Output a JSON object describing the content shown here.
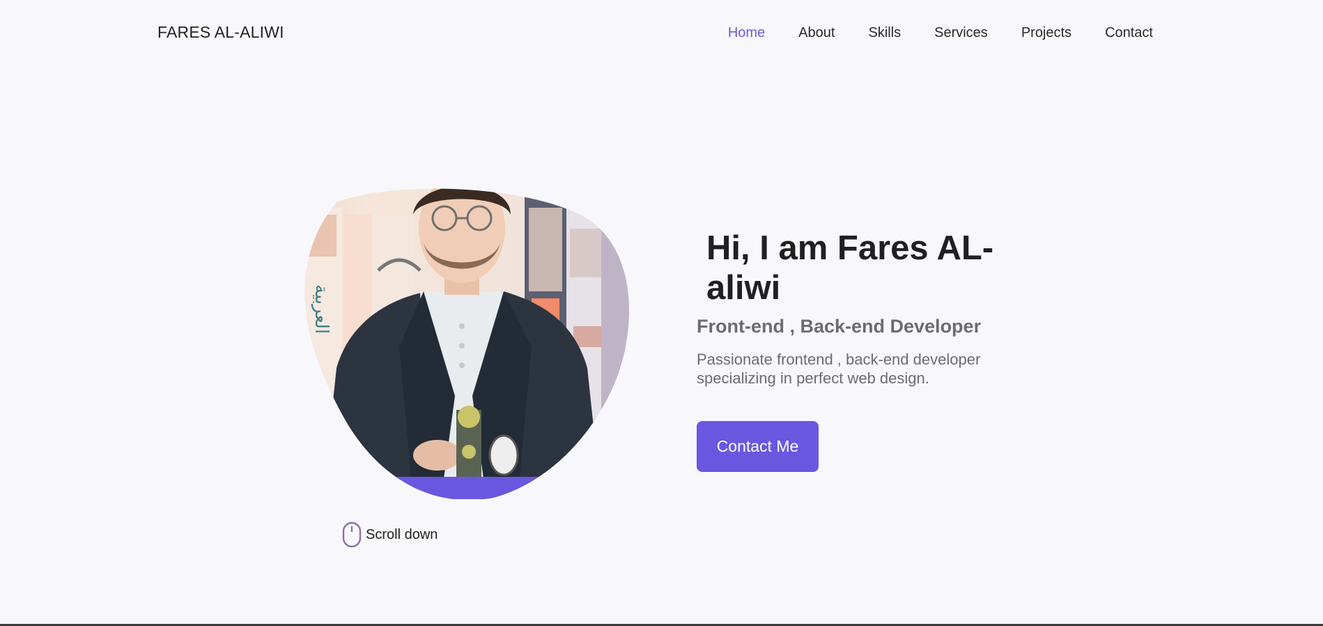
{
  "header": {
    "logo": "FARES AL-ALIWI",
    "nav": [
      {
        "label": "Home",
        "active": true
      },
      {
        "label": "About",
        "active": false
      },
      {
        "label": "Skills",
        "active": false
      },
      {
        "label": "Services",
        "active": false
      },
      {
        "label": "Projects",
        "active": false
      },
      {
        "label": "Contact",
        "active": false
      }
    ]
  },
  "hero": {
    "title": "Hi, I am Fares AL-aliwi",
    "subtitle": "Front-end , Back-end Developer",
    "description": "Passionate frontend , back-end developer specializing in perfect web design.",
    "button_label": "Contact Me",
    "scroll_label": "Scroll down",
    "image_icon": "profile-photo"
  },
  "colors": {
    "accent": "#6a57e0",
    "nav_active": "#6a5ad8",
    "background": "#f8f8fc",
    "muted_text": "#6b6b72"
  }
}
